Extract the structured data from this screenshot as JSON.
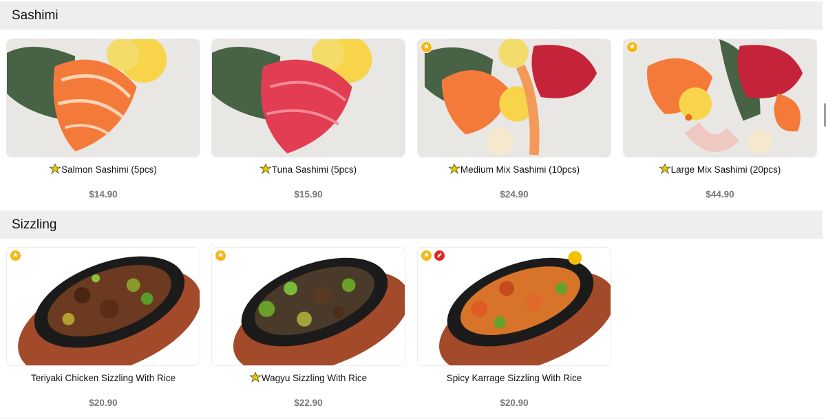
{
  "sections": [
    {
      "title": "Sashimi",
      "items": [
        {
          "name": "Salmon Sashimi (5pcs)",
          "price": "$14.90",
          "new": true,
          "badges": []
        },
        {
          "name": "Tuna Sashimi (5pcs)",
          "price": "$15.90",
          "new": true,
          "badges": []
        },
        {
          "name": "Medium Mix Sashimi (10pcs)",
          "price": "$24.90",
          "new": true,
          "badges": [
            "star-icon"
          ]
        },
        {
          "name": "Large Mix Sashimi (20pcs)",
          "price": "$44.90",
          "new": true,
          "badges": [
            "star-icon"
          ]
        }
      ]
    },
    {
      "title": "Sizzling",
      "items": [
        {
          "name": "Teriyaki Chicken Sizzling With Rice",
          "price": "$20.90",
          "new": false,
          "badges": [
            "star-icon"
          ]
        },
        {
          "name": "Wagyu Sizzling With Rice",
          "price": "$22.90",
          "new": true,
          "badges": [
            "star-icon"
          ]
        },
        {
          "name": "Spicy Karrage Sizzling With Rice",
          "price": "$20.90",
          "new": false,
          "badges": [
            "star-icon",
            "chili-icon"
          ]
        }
      ]
    }
  ],
  "colors": {
    "section_bg": "#eeeeee",
    "price": "#777777",
    "star_badge": "#f6b512",
    "chili_badge": "#e02424"
  }
}
